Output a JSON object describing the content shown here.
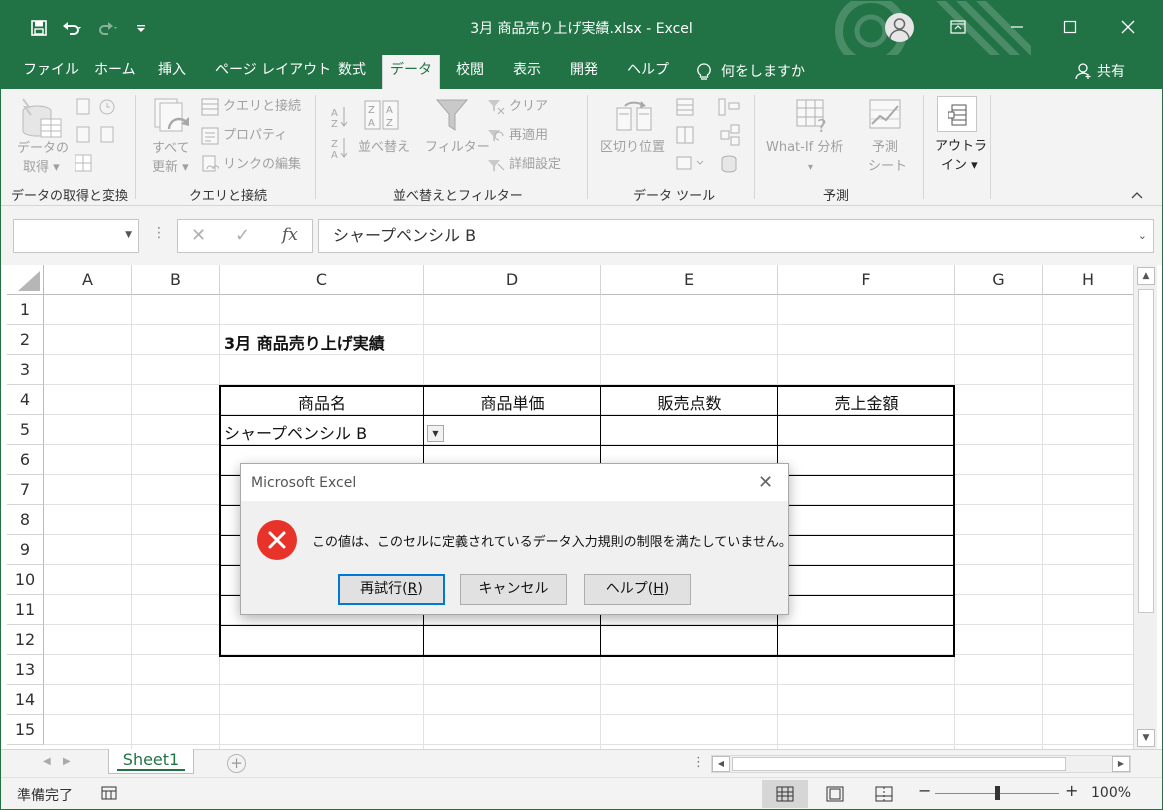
{
  "app": {
    "window_title": "3月 商品売り上げ実績.xlsx  -  Excel",
    "share_label": "共有",
    "colors": {
      "brand": "#217346",
      "error_icon": "#e8332b"
    }
  },
  "qat": {
    "icons": [
      "save-icon",
      "undo-icon",
      "redo-icon",
      "customize-qat-icon"
    ]
  },
  "ribbon": {
    "tabs": [
      "ファイル",
      "ホーム",
      "挿入",
      "ページ レイアウト",
      "数式",
      "データ",
      "校閲",
      "表示",
      "開発",
      "ヘルプ",
      "何をしますか"
    ],
    "active_tab": "データ",
    "groups": {
      "get_transform": {
        "label": "データの取得と変換",
        "get_data_line1": "データの",
        "get_data_line2": "取得 ▾"
      },
      "queries": {
        "label": "クエリと接続",
        "refresh_line1": "すべて",
        "refresh_line2": "更新 ▾",
        "queries_connections": "クエリと接続",
        "properties": "プロパティ",
        "edit_links": "リンクの編集"
      },
      "sort_filter": {
        "label": "並べ替えとフィルター",
        "sort": "並べ替え",
        "filter": "フィルター",
        "clear": "クリア",
        "reapply": "再適用",
        "advanced": "詳細設定"
      },
      "data_tools": {
        "label": "データ ツール",
        "text_to_columns": "区切り位置"
      },
      "forecast": {
        "label": "予測",
        "what_if": "What-If 分析",
        "forecast_sheet_line1": "予測",
        "forecast_sheet_line2": "シート"
      },
      "outline": {
        "line1": "アウトラ",
        "line2": "イン ▾"
      }
    }
  },
  "formula_bar": {
    "name_box": "",
    "value": "シャープペンシル B"
  },
  "sheet": {
    "columns": [
      "A",
      "B",
      "C",
      "D",
      "E",
      "F",
      "G",
      "H"
    ],
    "rows": [
      "1",
      "2",
      "3",
      "4",
      "5",
      "6",
      "7",
      "8",
      "9",
      "10",
      "11",
      "12",
      "13",
      "14",
      "15"
    ],
    "title": "3月 商品売り上げ実績",
    "table_headers": [
      "商品名",
      "商品単価",
      "販売点数",
      "売上金額"
    ],
    "c5": "シャープペンシル B"
  },
  "sheet_tabs": {
    "tabs": [
      "Sheet1"
    ]
  },
  "status_bar": {
    "status": "準備完了",
    "zoom": "100%"
  },
  "dialog": {
    "title": "Microsoft Excel",
    "message": "この値は、このセルに定義されているデータ入力規則の制限を満たしていません。",
    "retry": {
      "text": "再試行(",
      "key": "R",
      "end": ")"
    },
    "cancel": "キャンセル",
    "help": {
      "text": "ヘルプ(",
      "key": "H",
      "end": ")"
    }
  }
}
